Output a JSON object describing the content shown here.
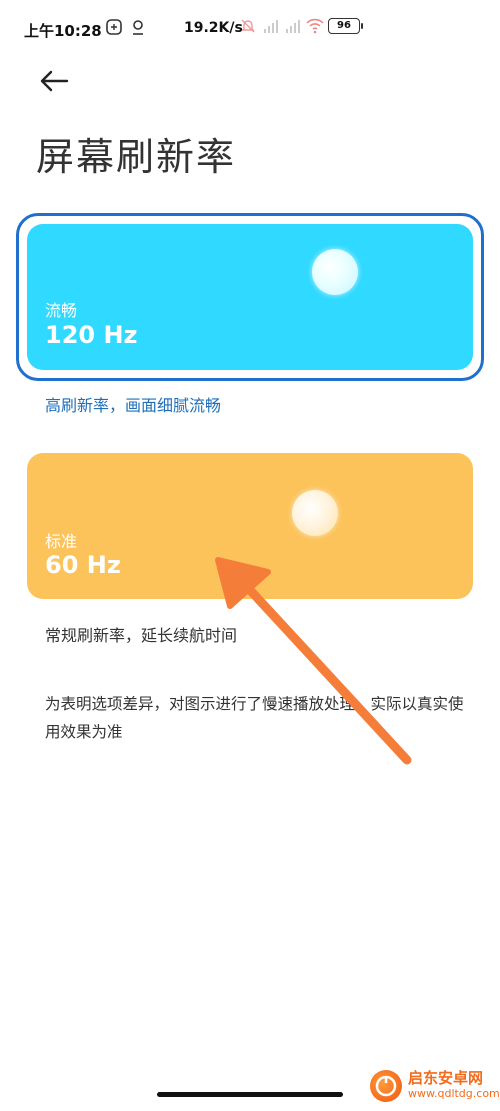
{
  "status_bar": {
    "time": "上午10:28",
    "net_speed": "19.2K/s",
    "battery": "96"
  },
  "page": {
    "title": "屏幕刷新率"
  },
  "options": [
    {
      "label": "流畅",
      "value": "120 Hz",
      "description": "高刷新率，画面细腻流畅",
      "selected": true
    },
    {
      "label": "标准",
      "value": "60 Hz",
      "description": "常规刷新率，延长续航时间",
      "selected": false
    }
  ],
  "note": "为表明选项差异，对图示进行了慢速播放处理，实际以真实使用效果为准",
  "watermark": {
    "name": "启东安卓网",
    "url": "www.qdltdg.com"
  },
  "colors": {
    "fast_card": "#2fd9ff",
    "standard_card": "#fcc35a",
    "selection_border": "#1f6fcf",
    "arrow": "#f57d3a",
    "desc_selected": "#1e6fb8"
  }
}
